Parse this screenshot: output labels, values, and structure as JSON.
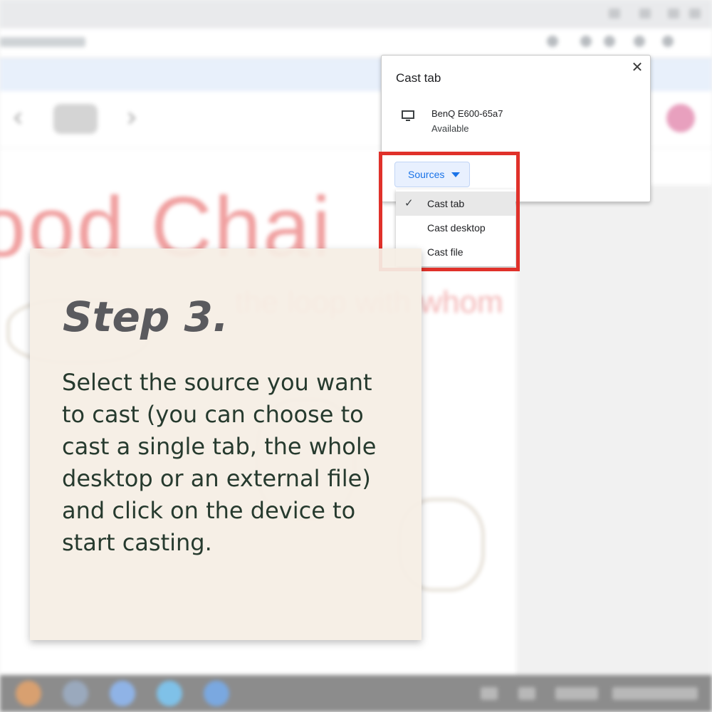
{
  "cast_dialog": {
    "title": "Cast tab",
    "close_glyph": "✕",
    "device": {
      "name": "BenQ E600-65a7",
      "status": "Available",
      "icon": "monitor-icon"
    }
  },
  "sources": {
    "button_label": "Sources",
    "options": [
      {
        "label": "Cast tab",
        "selected": true
      },
      {
        "label": "Cast desktop",
        "selected": false
      },
      {
        "label": "Cast file",
        "selected": false
      }
    ],
    "check_glyph": "✓"
  },
  "instruction": {
    "title": "Step 3.",
    "body_lines": [
      "Select the source you want",
      "to cast (you can choose to",
      "cast a single tab, the whole",
      "desktop or an external file)",
      "and click on the device to",
      "start casting."
    ]
  },
  "background": {
    "page_title": "ood Chai",
    "page_subtitle": "the loop with whom"
  },
  "colors": {
    "highlight": "#e0312a",
    "accent": "#1a73e8",
    "card_bg": "#f5eee4",
    "step_title": "#5a5a5e",
    "step_body": "#263a2e"
  }
}
